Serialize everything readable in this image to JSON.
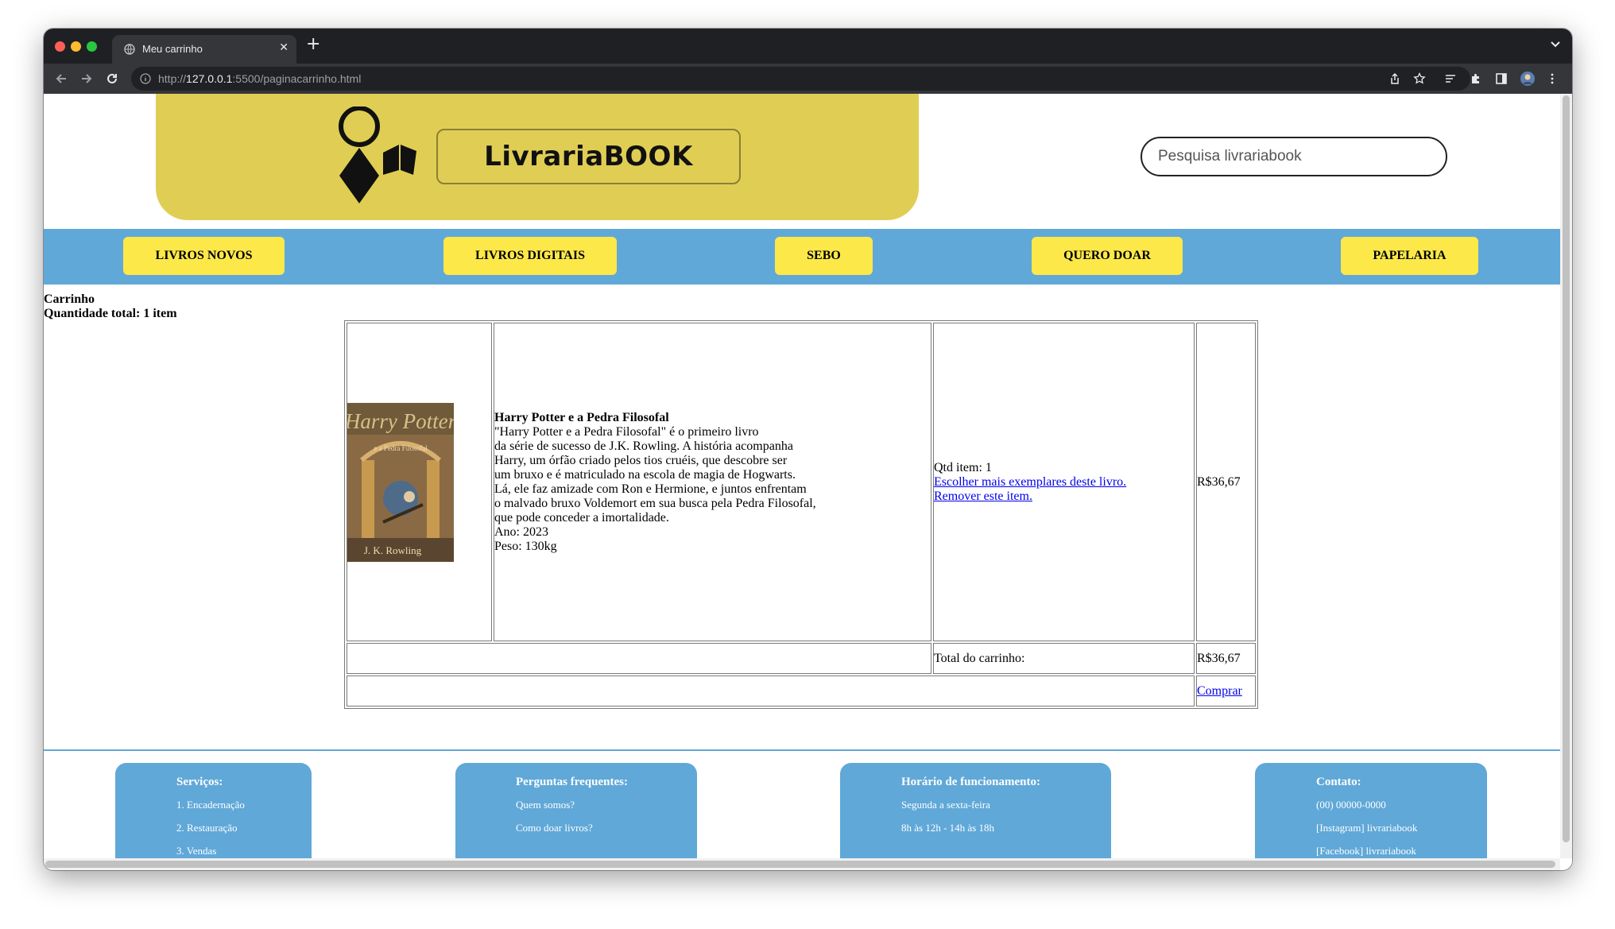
{
  "browser": {
    "tab_title": "Meu carrinho",
    "url_prefix": "http://",
    "url_host": "127.0.0.1",
    "url_rest": ":5500/paginacarrinho.html"
  },
  "header": {
    "logo_text": "LivrariaBOOK",
    "search_placeholder": "Pesquisa livrariabook"
  },
  "nav": {
    "items": [
      "LIVROS NOVOS",
      "LIVROS DIGITAIS",
      "SEBO",
      "QUERO DOAR",
      "PAPELARIA"
    ]
  },
  "cart": {
    "title": "Carrinho",
    "total_quantity": "Quantidade total: 1 item",
    "item": {
      "cover_title": "Harry Potter",
      "cover_subtitle": "e a Pedra Filosofal",
      "cover_author": "J. K. Rowling",
      "name": "Harry Potter e a Pedra Filosofal",
      "description_lines": [
        "\"Harry Potter e a Pedra Filosofal\" é o primeiro livro",
        "da série de sucesso de J.K. Rowling. A história acompanha",
        "Harry, um órfão criado pelos tios cruéis, que descobre ser",
        "um bruxo e é matriculado na escola de magia de Hogwarts.",
        "Lá, ele faz amizade com Ron e Hermione, e juntos enfrentam",
        "o malvado bruxo Voldemort em sua busca pela Pedra Filosofal,",
        "que pode conceder a imortalidade."
      ],
      "year": "Ano: 2023",
      "weight": "Peso: 130kg",
      "qty": "Qtd item: 1",
      "more_link": "Escolher mais exemplares deste livro.",
      "remove_link": "Remover este item.",
      "price": "R$36,67"
    },
    "total_label": "Total do carrinho:",
    "total_value": "R$36,67",
    "buy_link": "Comprar"
  },
  "footer": {
    "services": {
      "title": "Serviços:",
      "items": [
        "1. Encadernação",
        "2. Restauração",
        "3. Vendas"
      ]
    },
    "faq": {
      "title": "Perguntas frequentes:",
      "items": [
        "Quem somos?",
        "Como doar livros?"
      ]
    },
    "hours": {
      "title": "Horário de funcionamento:",
      "items": [
        "Segunda a sexta-feira",
        "8h às 12h - 14h às 18h"
      ]
    },
    "contact": {
      "title": "Contato:",
      "items": [
        "(00) 00000-0000",
        "[Instagram] livrariabook",
        "[Facebook] livrariabook"
      ]
    }
  },
  "colors": {
    "banner": "#e0ce54",
    "nav_bar": "#60a8d8",
    "nav_button": "#fde84a",
    "footer_card": "#60a8d8",
    "link": "#0000ee"
  }
}
